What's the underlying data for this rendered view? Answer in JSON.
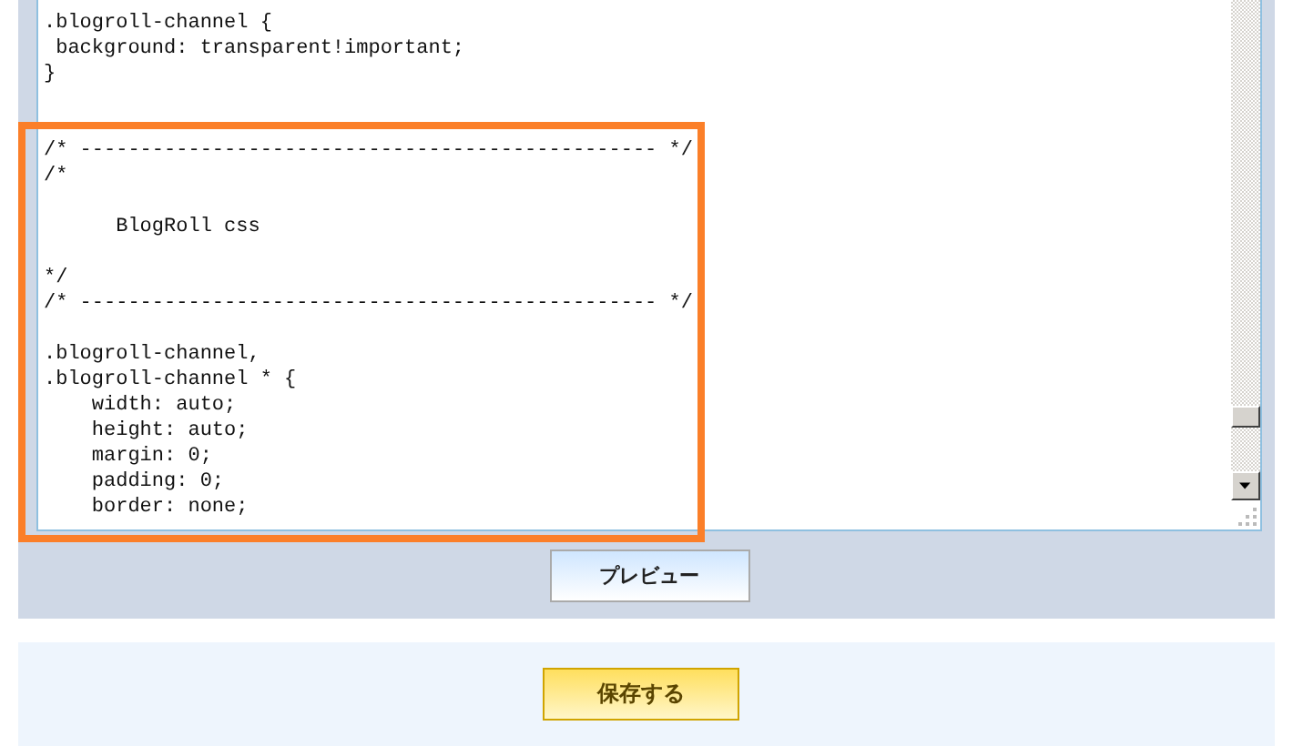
{
  "editor": {
    "lines": [
      {
        "kind": "code",
        "text": ".blogroll-channel {"
      },
      {
        "kind": "code",
        "text": " background: transparent!important;"
      },
      {
        "kind": "code",
        "text": "}"
      },
      {
        "kind": "blank"
      },
      {
        "kind": "blank"
      },
      {
        "kind": "code",
        "text": "/* ------------------------------------------------ */"
      },
      {
        "kind": "code",
        "text": "/*"
      },
      {
        "kind": "blank"
      },
      {
        "kind": "code",
        "text": "      BlogRoll css"
      },
      {
        "kind": "blank"
      },
      {
        "kind": "code",
        "text": "*/"
      },
      {
        "kind": "code",
        "text": "/* ------------------------------------------------ */"
      },
      {
        "kind": "blank"
      },
      {
        "kind": "code",
        "text": ".blogroll-channel,"
      },
      {
        "kind": "code",
        "text": ".blogroll-channel * {"
      },
      {
        "kind": "code",
        "text": "    width: auto;"
      },
      {
        "kind": "code",
        "text": "    height: auto;"
      },
      {
        "kind": "code",
        "text": "    margin: 0;"
      },
      {
        "kind": "code",
        "text": "    padding: 0;"
      },
      {
        "kind": "code",
        "text": "    border: none;"
      }
    ]
  },
  "preview_button": {
    "label": "プレビュー"
  },
  "save_button": {
    "label": "保存する"
  }
}
